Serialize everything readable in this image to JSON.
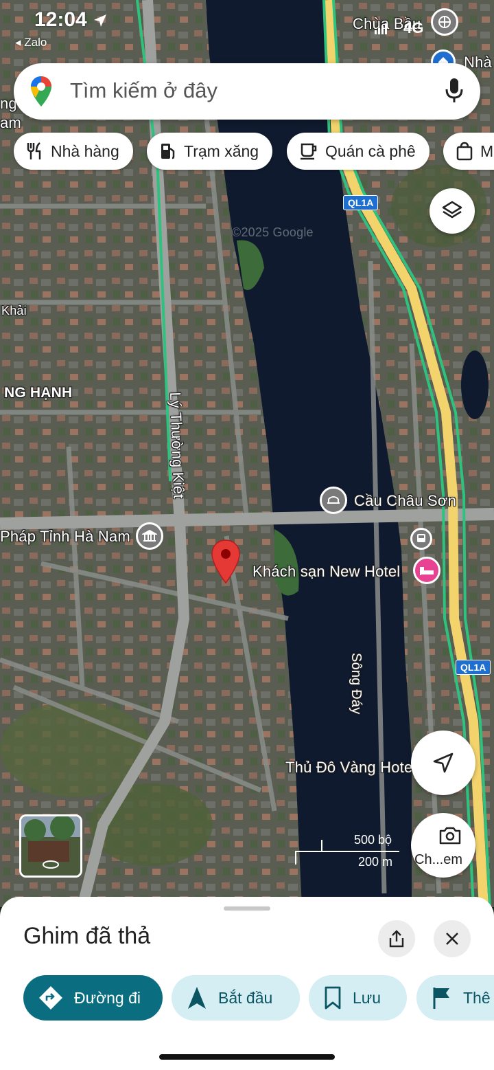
{
  "status_bar": {
    "time": "12:04",
    "back_app": "◂ Zalo",
    "network": "4G"
  },
  "search": {
    "placeholder": "Tìm kiếm ở đây"
  },
  "chips": [
    {
      "label": "Nhà hàng",
      "icon": "fork-knife-icon"
    },
    {
      "label": "Trạm xăng",
      "icon": "gas-station-icon"
    },
    {
      "label": "Quán cà phê",
      "icon": "coffee-icon"
    },
    {
      "label": "M",
      "icon": "shopping-bag-icon"
    }
  ],
  "map": {
    "labels": {
      "chua_bau": "Chùa Bầu",
      "nha": "Nhà",
      "ng_left": "ng",
      "am_left": "am",
      "khai": "Khải",
      "ng_hanh": "NG HẠNH",
      "ly_thuong_kiet": "Lý Thường Kiệt",
      "ql1a_top": "QL1A",
      "ql1a_bottom": "QL1A",
      "cau_chau_son": "Cầu Châu Sơn",
      "phap_tinh_ha_nam": "Pháp Tỉnh Hà Nam",
      "khach_san": "Khách sạn New Hotel",
      "song_day": "Sông Đáy",
      "thu_do_vang": "Thủ Đô Vàng Hotel",
      "watermark": "©2025 Google"
    },
    "scale": {
      "imperial": "500 bộ",
      "metric": "200 m"
    },
    "street_view_label": "Ch...em"
  },
  "sheet": {
    "title": "Ghim đã thả",
    "actions": [
      {
        "label": "Đường đi",
        "icon": "directions-icon"
      },
      {
        "label": "Bắt đầu",
        "icon": "navigation-arrow-icon"
      },
      {
        "label": "Lưu",
        "icon": "bookmark-icon"
      },
      {
        "label": "Thê",
        "icon": "flag-icon"
      }
    ]
  },
  "colors": {
    "primary": "#0b6e80",
    "secondary_bg": "#d4eef4",
    "pin": "#e53935",
    "river": "#0f1a2e",
    "highway": "#f3d36b",
    "traffic_green": "#2ec27e"
  }
}
